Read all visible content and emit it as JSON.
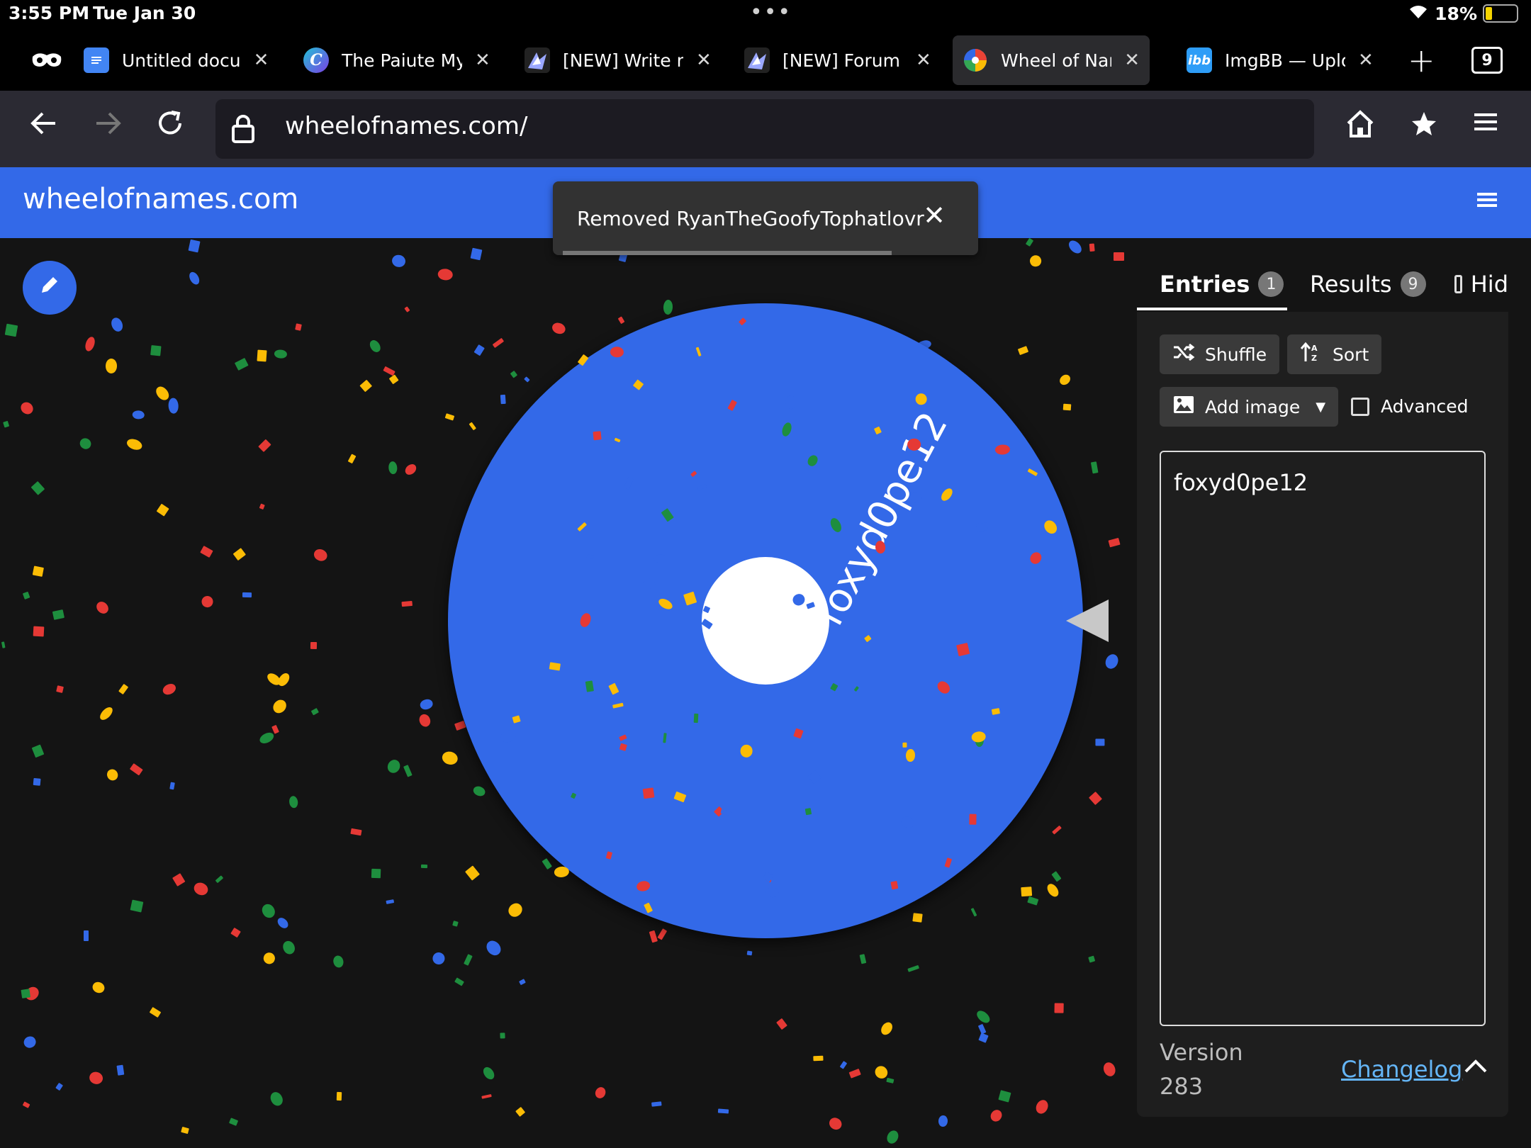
{
  "status": {
    "time": "3:55 PM",
    "date": "Tue Jan 30",
    "battery": "18%"
  },
  "tabs": [
    {
      "title": "Untitled docu",
      "icon": "google-docs-icon"
    },
    {
      "title": "The Paiute Myt",
      "icon": "c-logo-icon"
    },
    {
      "title": "[NEW] Write n",
      "icon": "forum-sprite-icon"
    },
    {
      "title": "[NEW] Forum T",
      "icon": "forum-sprite-icon"
    },
    {
      "title": "Wheel of Name",
      "icon": "wheel-of-names-icon",
      "active": true
    },
    {
      "title": "ImgBB — Uploa",
      "icon": "ibb-icon"
    }
  ],
  "tab_count": "9",
  "address": {
    "url": "wheelofnames.com/"
  },
  "site": {
    "logo": "wheelofnames.com"
  },
  "toast": {
    "message": "Removed RyanTheGoofyTophatlovr"
  },
  "wheel": {
    "entries": [
      "foxyd0pe12"
    ],
    "color": "#3369e8"
  },
  "panel": {
    "entries_tab": "Entries",
    "entries_count": "1",
    "results_tab": "Results",
    "results_count": "9",
    "hide_label": "Hid",
    "shuffle": "Shuffle",
    "sort": "Sort",
    "add_image": "Add image",
    "advanced": "Advanced",
    "entries_text": "foxyd0pe12",
    "version_label": "Version",
    "version_number": "283",
    "changelog": "Changelog"
  },
  "colors": {
    "accent": "#3369e8",
    "confetti": [
      "#e53935",
      "#1e8e3e",
      "#fbbc05",
      "#3369e8"
    ]
  }
}
